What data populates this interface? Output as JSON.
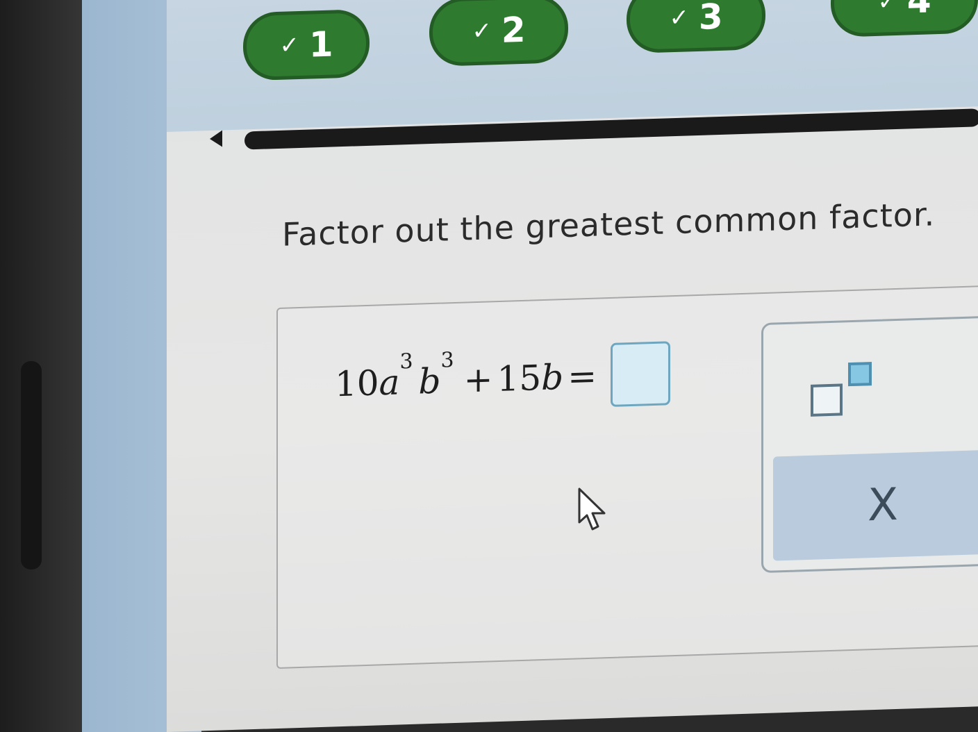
{
  "progress_steps": [
    {
      "label": "1",
      "check": "✓",
      "status": "completed"
    },
    {
      "label": "2",
      "check": "✓",
      "status": "completed"
    },
    {
      "label": "3",
      "check": "✓",
      "status": "completed"
    },
    {
      "label": "4",
      "check": "✓",
      "status": "completed"
    }
  ],
  "instruction": "Factor out the greatest common factor.",
  "equation": {
    "coef1": "10",
    "var_a": "a",
    "exp_a": "3",
    "var_b": "b",
    "exp_b": "3",
    "plus": "+",
    "coef2": "15",
    "var_b2": "b",
    "equals": "=",
    "answer_value": ""
  },
  "tools": {
    "exponent_icon": "exponent-template-icon",
    "clear_label": "X"
  },
  "colors": {
    "step_green": "#2e7a2f",
    "answer_box_fill": "#d7ecf5",
    "clear_button_bg": "#b9cbdc"
  }
}
